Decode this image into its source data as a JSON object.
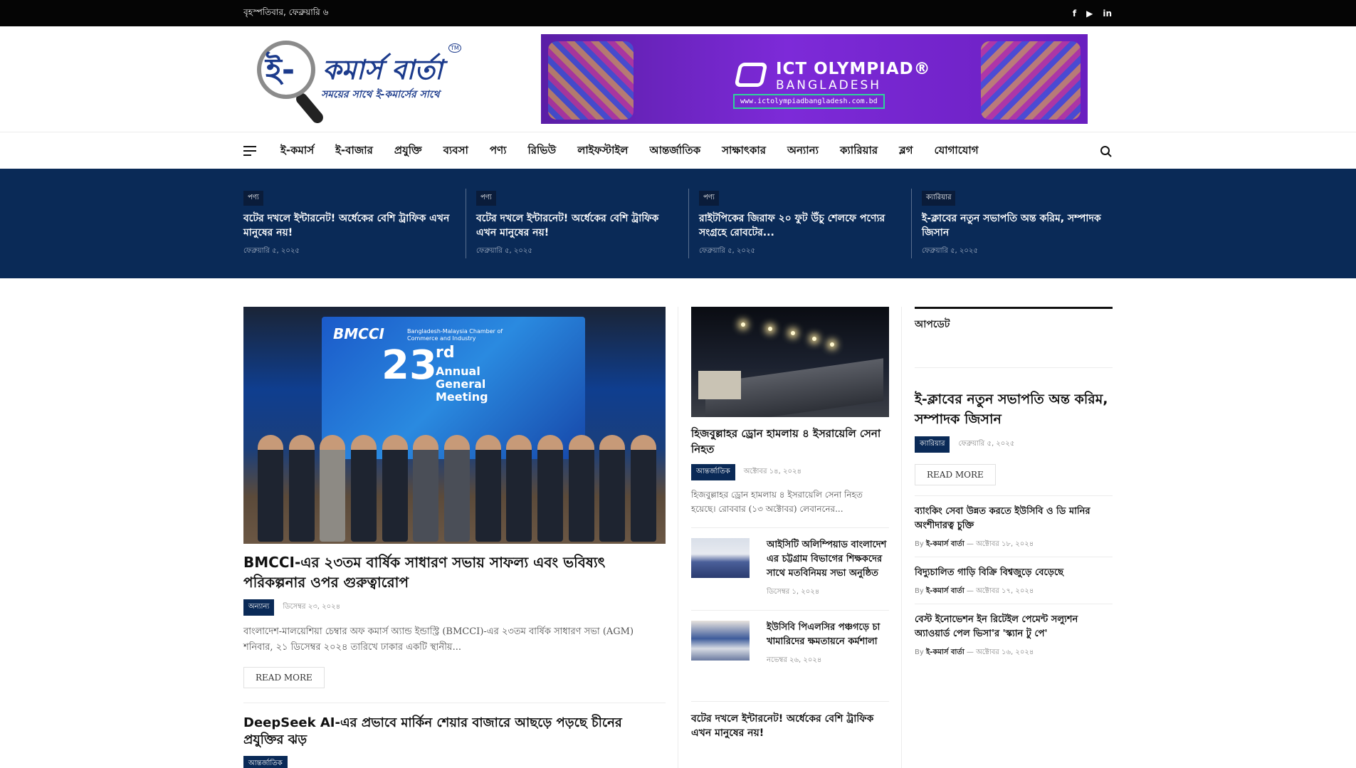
{
  "topbar": {
    "date": "বৃহস্পতিবার, ফেব্রুয়ারি ৬",
    "social": [
      "f",
      "▶",
      "in"
    ]
  },
  "logo": {
    "mark": "ই-",
    "name": "কমার্স বার্তা",
    "tagline": "সময়ের সাথে ই-কমার্সের সাথে",
    "tm": "TM"
  },
  "banner": {
    "title": "ICT OLYMPIAD®",
    "subtitle": "BANGLADESH",
    "url": "www.ictolympiadbangladesh.com.bd"
  },
  "nav": {
    "items": [
      "ই-কমার্স",
      "ই-বাজার",
      "প্রযুক্তি",
      "ব্যবসা",
      "পণ্য",
      "রিভিউ",
      "লাইফস্টাইল",
      "আন্তর্জাতিক",
      "সাক্ষাৎকার",
      "অন্যান্য",
      "ক্যারিয়ার",
      "ব্লগ",
      "যোগাযোগ"
    ]
  },
  "ticker": [
    {
      "cat": "পণ্য",
      "title": "বটের দখলে ইন্টারনেট! অর্ধেকের বেশি ট্রাফিক এখন মানুষের নয়!",
      "date": "ফেব্রুয়ারি ৫, ২০২৫"
    },
    {
      "cat": "পণ্য",
      "title": "বটের দখলে ইন্টারনেট! অর্ধেকের বেশি ট্রাফিক এখন মানুষের নয়!",
      "date": "ফেব্রুয়ারি ৫, ২০২৫"
    },
    {
      "cat": "পণ্য",
      "title": "রাইটপিকের জিরাফ ২০ ফুট উঁচু শেলফে পণ্যের সংগ্রহে রোবটের...",
      "date": "ফেব্রুয়ারি ৫, ২০২৫"
    },
    {
      "cat": "ক্যারিয়ার",
      "title": "ই-ক্লাবের নতুন সভাপতি অন্ত করিম, সম্পাদক জিসান",
      "date": "ফেব্রুয়ারি ৫, ২০২৫"
    }
  ],
  "hero": {
    "image_text": {
      "bmcci": "BMCCI",
      "sub": "Bangladesh-Malaysia Chamber of Commerce and Industry",
      "num": "23",
      "sup": "rd",
      "agm": "Annual General Meeting"
    },
    "title": "BMCCI-এর ২৩তম বার্ষিক সাধারণ সভায় সাফল্য এবং ভবিষ্যৎ পরিকল্পনার ওপর গুরুত্বারোপ",
    "cat": "অন্যান্য",
    "date": "ডিসেম্বর ২৩, ২০২৪",
    "excerpt": "বাংলাদেশ-মালয়েশিয়া চেম্বার অফ কমার্স অ্যান্ড ইন্ডাস্ট্রি (BMCCI)-এর ২৩তম বার্ষিক সাধারণ সভা (AGM) শনিবার, ২১ ডিসেম্বর ২০২৪ তারিখে ঢাকার একটি স্থানীয়...",
    "read_more": "READ MORE"
  },
  "second": {
    "title": "DeepSeek AI-এর প্রভাবে মার্কিন শেয়ার বাজারে আছড়ে পড়ছে চীনের প্রযুক্তির ঝড়",
    "cat": "আন্তর্জাতিক"
  },
  "middle": {
    "title": "হিজবুল্লাহর ড্রোন হামলায় ৪ ইসরায়েলি সেনা নিহত",
    "cat": "আন্তর্জাতিক",
    "date": "অক্টোবর ১৪, ২০২৪",
    "excerpt": "হিজবুল্লাহর ড্রোন হামলায় ৪ ইসরায়েলি সেনা নিহত হয়েছে। রোববার (১৩ অক্টোবর) লেবাননের...",
    "mini": [
      {
        "title": "আইসিটি অলিম্পিয়াড বাংলাদেশ এর চট্টগ্রাম বিভাগের শিক্ষকদের সাথে মতবিনিময় সভা অনুষ্ঠিত",
        "date": "ডিসেম্বর ১, ২০২৪"
      },
      {
        "title": "ইউসিবি পিএলসির পঞ্চগড়ে চা খামারিদের ক্ষমতায়নে কর্মশালা",
        "date": "নভেম্বর ২৬, ২০২৪"
      }
    ],
    "last": "বটের দখলে ইন্টারনেট! অর্ধেকের বেশি ট্রাফিক এখন মানুষের নয়!"
  },
  "sidebar": {
    "heading": "আপডেট",
    "feature": {
      "title": "ই-ক্লাবের নতুন সভাপতি অন্ত করিম, সম্পাদক জিসান",
      "cat": "ক্যারিয়ার",
      "date": "ফেব্রুয়ারি ৫, ২০২৫",
      "read_more": "READ MORE"
    },
    "by": "By",
    "author": "ই-কমার্স বার্তা",
    "dash": "—",
    "items": [
      {
        "title": "ব্যাংকিং সেবা উন্নত করতে ইউসিবি ও ডি মানির অংশীদারত্ব চুক্তি",
        "date": "অক্টোবর ১৮, ২০২৪"
      },
      {
        "title": "বিদ্যুচালিত গাড়ি বিক্রি বিশ্বজুড়ে বেড়েছে",
        "date": "অক্টোবর ১৭, ২০২৪"
      },
      {
        "title": "বেস্ট ইনোভেশন ইন রিটেইল পেমেন্ট সল্যুশন অ্যাওয়ার্ড পেল ভিসা'র 'স্ক্যান টু পে'",
        "date": "অক্টোবর ১৬, ২০২৪"
      }
    ]
  }
}
